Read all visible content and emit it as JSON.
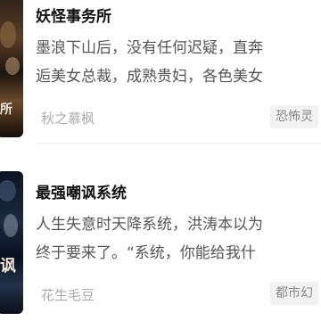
{
  "books": [
    {
      "title": "妖怪事务所",
      "desc_line1": "墨浪下山后，没有任何迟疑，直奔",
      "desc_line2": "逅美女总裁，成熟贵妇，各色美女",
      "author": "秋之慕枫",
      "genre": "恐怖灵",
      "cover_text": "所"
    },
    {
      "title": "最强嘲讽系统",
      "desc_line1": "人生失意时天降系统，洪涛本以为",
      "desc_line2": "终于要来了。“系统，你能给我什",
      "author": "花生毛豆",
      "genre": "都市幻",
      "cover_text": "讽"
    }
  ]
}
